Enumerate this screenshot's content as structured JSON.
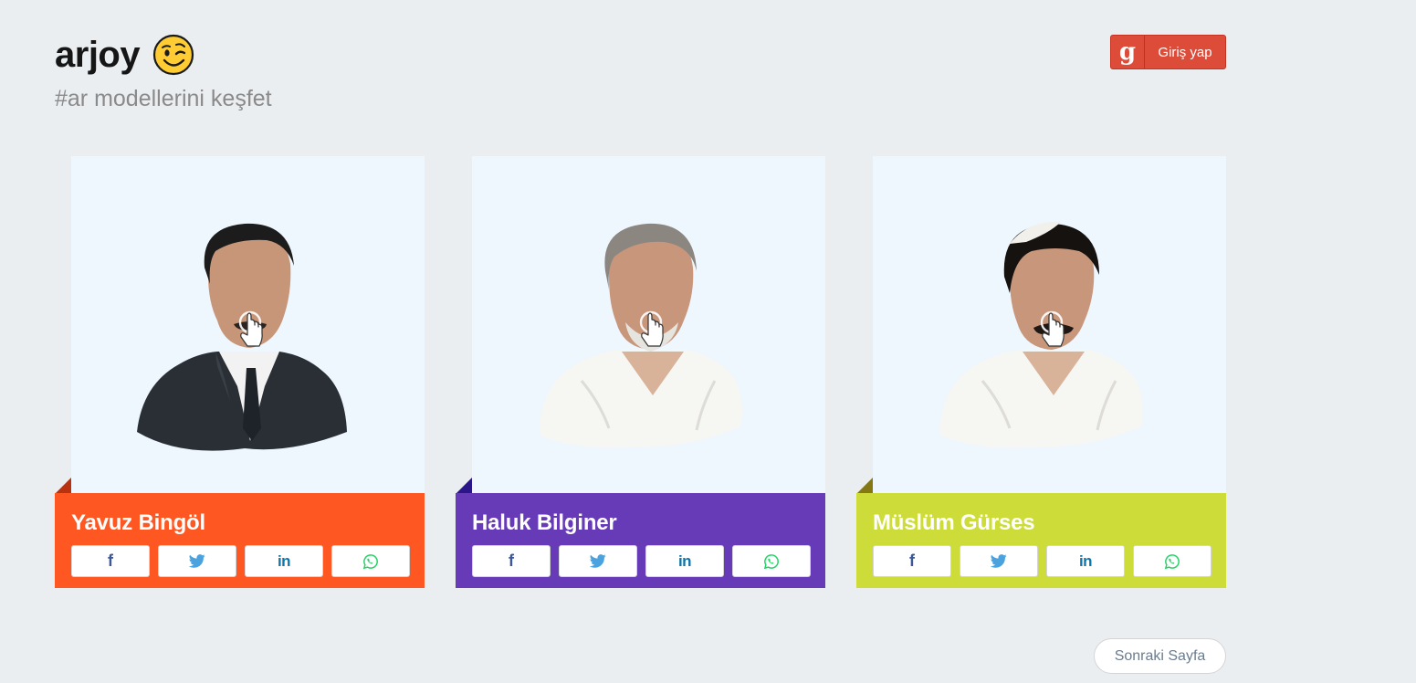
{
  "brand": {
    "name": "arjoy",
    "emoji_icon": "winking-face-icon"
  },
  "tagline": "#ar modellerini keşfet",
  "login": {
    "label": "Giriş yap",
    "icon": "google-plus-icon",
    "color": "#dd4b39"
  },
  "cards": [
    {
      "name": "Yavuz Bingöl",
      "accent": "#ff5722",
      "fold_color": "#b83210",
      "style": "suit"
    },
    {
      "name": "Haluk Bilginer",
      "accent": "#673ab7",
      "fold_color": "#2b1688",
      "style": "white"
    },
    {
      "name": "Müslüm Gürses",
      "accent": "#cddc39",
      "fold_color": "#857712",
      "style": "white"
    }
  ],
  "share_icons": [
    "facebook-icon",
    "twitter-icon",
    "linkedin-icon",
    "whatsapp-icon"
  ],
  "touch_icon": "touch-hand-icon",
  "pagination": {
    "next_label": "Sonraki Sayfa"
  }
}
